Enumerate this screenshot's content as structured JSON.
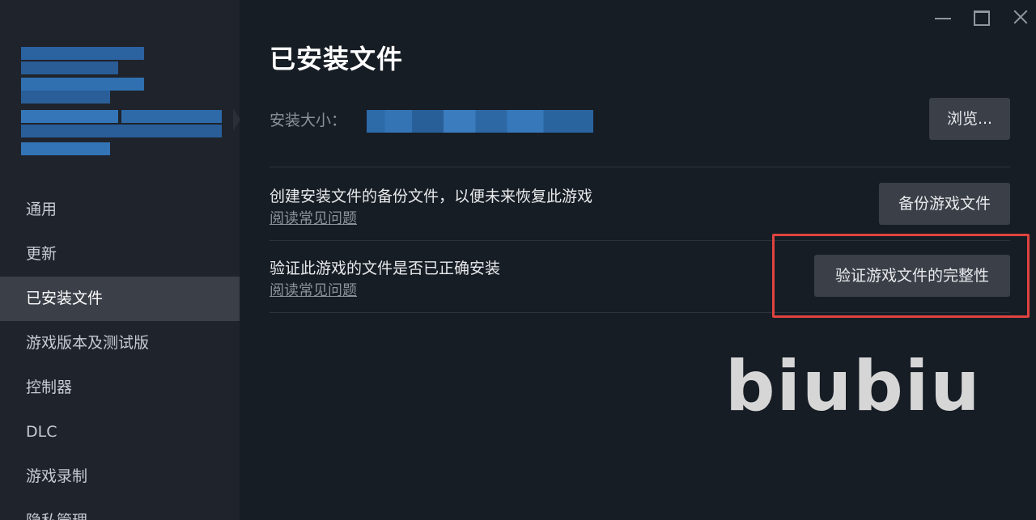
{
  "window_controls": {
    "minimize_icon": "minimize-icon",
    "maximize_icon": "maximize-icon",
    "close_icon": "close-icon"
  },
  "sidebar": {
    "items": [
      {
        "label": "通用",
        "active": false
      },
      {
        "label": "更新",
        "active": false
      },
      {
        "label": "已安装文件",
        "active": true
      },
      {
        "label": "游戏版本及测试版",
        "active": false
      },
      {
        "label": "控制器",
        "active": false
      },
      {
        "label": "DLC",
        "active": false
      },
      {
        "label": "游戏录制",
        "active": false
      },
      {
        "label": "隐私管理",
        "active": false
      }
    ]
  },
  "main": {
    "title": "已安装文件",
    "install_size_label": "安装大小：",
    "browse_label": "浏览...",
    "backup": {
      "description": "创建安装文件的备份文件，以便未来恢复此游戏",
      "faq_link": "阅读常见问题",
      "button_label": "备份游戏文件"
    },
    "verify": {
      "description": "验证此游戏的文件是否已正确安装",
      "faq_link": "阅读常见问题",
      "button_label": "验证游戏文件的完整性"
    }
  },
  "watermark": "biubiu",
  "colors": {
    "background": "#171d25",
    "sidebar": "#1f232b",
    "active_item": "#3a3f48",
    "button": "#3a3f48",
    "highlight": "#e0433f"
  }
}
